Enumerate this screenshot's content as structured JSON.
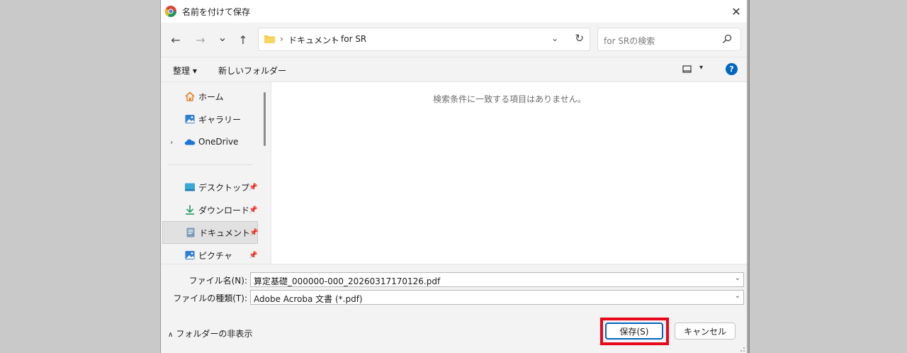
{
  "window": {
    "title": "名前を付けて保存",
    "close_glyph": "✕"
  },
  "nav": {
    "back_glyph": "←",
    "forward_glyph": "→",
    "recent_glyph": "⌄",
    "up_glyph": "↑"
  },
  "address": {
    "crumbs": [
      "ドキュメント",
      "for SR"
    ],
    "separator": "›",
    "dropdown_glyph": "⌄",
    "refresh_glyph": "↻"
  },
  "search": {
    "placeholder": "for SRの検索"
  },
  "toolbar": {
    "organize_label": "整理 ▾",
    "new_folder_label": "新しいフォルダー",
    "view_dropdown": "▾",
    "help_label": "?"
  },
  "sidebar": {
    "items": [
      {
        "label": "ホーム",
        "icon": "home-icon"
      },
      {
        "label": "ギャラリー",
        "icon": "gallery-icon"
      },
      {
        "label": "OneDrive",
        "icon": "onedrive-icon",
        "expander": "›"
      },
      {
        "label": "デスクトップ",
        "icon": "desktop-icon",
        "pinned": true
      },
      {
        "label": "ダウンロード",
        "icon": "download-icon",
        "pinned": true
      },
      {
        "label": "ドキュメント",
        "icon": "document-icon",
        "pinned": true,
        "selected": true
      },
      {
        "label": "ピクチャ",
        "icon": "pictures-icon",
        "pinned": true
      }
    ],
    "pin_glyph": "📌"
  },
  "content": {
    "empty_message": "検索条件に一致する項目はありません。"
  },
  "form": {
    "filename_label": "ファイル名(N):",
    "filename_value": "算定基礎_000000-000_20260317170126.pdf",
    "filetype_label": "ファイルの種類(T):",
    "filetype_value": "Adobe Acroba 文書 (*.pdf)",
    "combo_arrow": "⌄"
  },
  "footer": {
    "hide_folders_label": "フォルダーの非表示",
    "hide_folders_chevron": "∧",
    "save_label": "保存(S)",
    "cancel_label": "キャンセル"
  },
  "colors": {
    "accent": "#0067c0",
    "highlight_box": "#e8071b",
    "folder": "#f2c94c"
  }
}
